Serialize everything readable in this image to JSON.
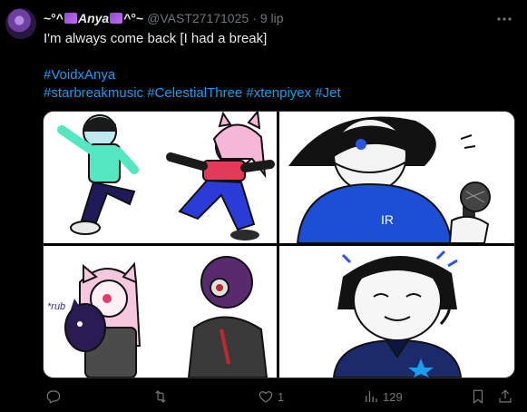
{
  "post": {
    "display_name": "~°^Anya^°~",
    "display_prefix": "~°^",
    "display_core": "Anya",
    "display_suffix": "^°~",
    "handle": "@VAST27171025",
    "separator": "·",
    "time": "9 lip",
    "text_line1": "I'm always come back [I had a break]",
    "hashtag_line1": "#VoidxAnya",
    "hashtag_line2": "#starbreakmusic #CelestialThree #xtenpiyex #Jet"
  },
  "images": {
    "panel1_label": "",
    "panel3_label": "*rub"
  },
  "actions": {
    "reply_count": "",
    "repost_count": "",
    "like_count": "1",
    "views_count": "129"
  },
  "colors": {
    "accent": "#1d9bf0",
    "muted": "#71767b",
    "background": "#000000"
  },
  "icons": [
    "more-icon",
    "reply-icon",
    "repost-icon",
    "like-icon",
    "views-icon",
    "bookmark-icon",
    "share-icon"
  ]
}
